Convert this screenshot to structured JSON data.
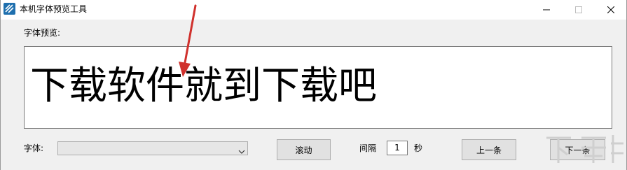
{
  "window": {
    "title": "本机字体预览工具",
    "controls": {
      "minimize": "minimize-icon",
      "maximize": "maximize-icon",
      "close": "close-icon"
    }
  },
  "preview": {
    "label": "字体预览:",
    "sample_text": "下载软件就到下载吧"
  },
  "controls": {
    "font_label": "字体:",
    "font_value": "",
    "scroll_button": "滚动",
    "interval_label": "间隔",
    "interval_value": "1",
    "interval_unit": "秒",
    "prev_button": "上一条",
    "next_button": "下一条"
  },
  "colors": {
    "annotation_arrow": "#d0312d",
    "window_bg": "#f0f0f0",
    "app_icon": "#1e6fae"
  }
}
